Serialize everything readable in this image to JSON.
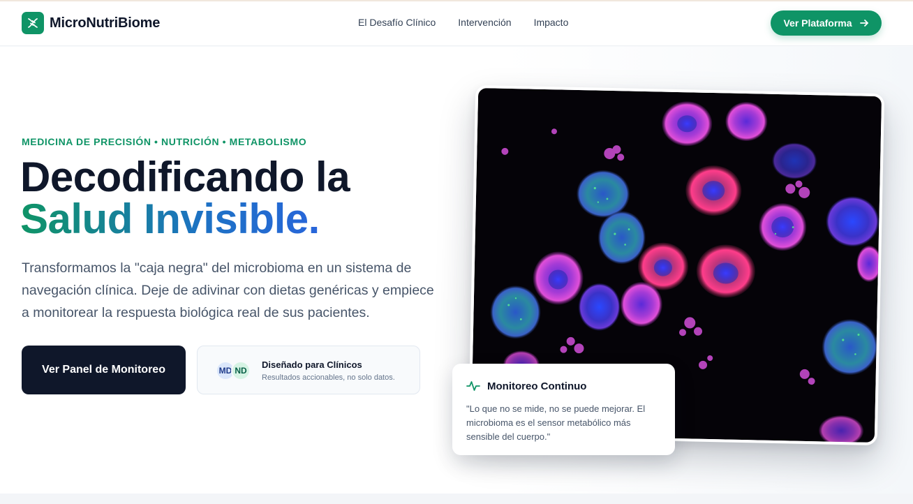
{
  "brand": {
    "name": "MicroNutriBiome",
    "icon": "dna-icon",
    "color": "#0f9466"
  },
  "nav": {
    "items": [
      {
        "label": "El Desafío Clínico"
      },
      {
        "label": "Intervención"
      },
      {
        "label": "Impacto"
      }
    ],
    "cta_label": "Ver Plataforma",
    "cta_icon": "arrow-right-icon"
  },
  "hero": {
    "eyebrow": "MEDICINA DE PRECISIÓN • NUTRICIÓN • METABOLISMO",
    "headline_line1": "Decodificando la",
    "headline_line2": "Salud Invisible.",
    "lead": "Transformamos la \"caja negra\" del microbioma en un sistema de navegación clínica. Deje de adivinar con dietas genéricas y empiece a monitorear la respuesta biológica real de sus pacientes.",
    "primary_button": "Ver Panel de Monitoreo",
    "trust": {
      "avatars": [
        "MD",
        "ND"
      ],
      "title": "Diseñado para Clínicos",
      "subtitle": "Resultados accionables, no solo datos."
    }
  },
  "image_card": {
    "subject": "fluorescent-microscopy-cells"
  },
  "quote_card": {
    "icon": "activity-pulse-icon",
    "title": "Monitoreo Continuo",
    "text": "\"Lo que no se mide, no se puede mejorar. El microbioma es el sensor metabólico más sensible del cuerpo.\""
  },
  "colors": {
    "accent_green": "#0f9466",
    "accent_blue": "#2b62e0",
    "dark": "#0f172a",
    "muted_text": "#475569"
  }
}
